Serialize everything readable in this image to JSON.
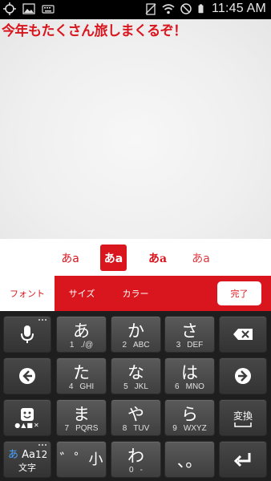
{
  "status_bar": {
    "time": "11:45 AM",
    "left_icons": [
      "location-icon",
      "image-icon",
      "keyboard-icon"
    ],
    "right_icons": [
      "no-sim-icon",
      "wifi-icon",
      "do-not-disturb-icon",
      "battery-icon"
    ]
  },
  "canvas": {
    "text": "今年もたくさん旅しまくるぞ！"
  },
  "font_styles": {
    "items": [
      {
        "label": "あa",
        "selected": false
      },
      {
        "label": "あa",
        "selected": true
      },
      {
        "label": "あa",
        "selected": false
      },
      {
        "label": "あa",
        "selected": false
      }
    ]
  },
  "tabs": {
    "font": "フォント",
    "size": "サイズ",
    "color": "カラー",
    "done": "完了"
  },
  "keyboard": {
    "row1": {
      "k1": {
        "main": "あ",
        "num": "1",
        "sub": "./@"
      },
      "k2": {
        "main": "か",
        "num": "2",
        "sub": "ABC"
      },
      "k3": {
        "main": "さ",
        "num": "3",
        "sub": "DEF"
      }
    },
    "row2": {
      "k1": {
        "main": "た",
        "num": "4",
        "sub": "GHI"
      },
      "k2": {
        "main": "な",
        "num": "5",
        "sub": "JKL"
      },
      "k3": {
        "main": "は",
        "num": "6",
        "sub": "MNO"
      }
    },
    "row3": {
      "k1": {
        "main": "ま",
        "num": "7",
        "sub": "PQRS"
      },
      "k2": {
        "main": "や",
        "num": "8",
        "sub": "TUV"
      },
      "k3": {
        "main": "ら",
        "num": "9",
        "sub": "WXYZ"
      }
    },
    "row4": {
      "k1": {
        "main": "゛゜小"
      },
      "k2": {
        "main": "わ",
        "num": "0",
        "sub": "-"
      },
      "k3": {
        "main": "、。"
      }
    },
    "mode_key": {
      "kana": "あ",
      "alpha": "Aa",
      "num": "12",
      "label": "文字"
    },
    "convert_label": "変換",
    "accent_color": "#d9161e"
  }
}
